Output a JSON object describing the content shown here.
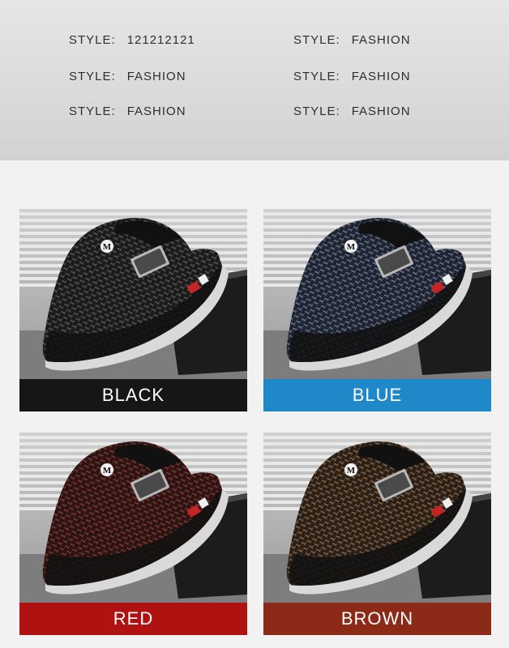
{
  "specs": [
    {
      "key": "STYLE:",
      "value": "121212121"
    },
    {
      "key": "STYLE:",
      "value": "FASHION"
    },
    {
      "key": "STYLE:",
      "value": "FASHION"
    },
    {
      "key": "STYLE:",
      "value": "FASHION"
    },
    {
      "key": "STYLE:",
      "value": "FASHION"
    },
    {
      "key": "STYLE:",
      "value": "FASHION"
    }
  ],
  "colors": [
    {
      "label": "BLACK",
      "bar_color": "#161616",
      "shoe_color": "#1b1b1b",
      "pattern_color": "#5a5a5a"
    },
    {
      "label": "BLUE",
      "bar_color": "#1e88c8",
      "shoe_color": "#1f2430",
      "pattern_color": "#6b7a93"
    },
    {
      "label": "RED",
      "bar_color": "#b01212",
      "shoe_color": "#2a1414",
      "pattern_color": "#8a3a2e"
    },
    {
      "label": "BROWN",
      "bar_color": "#8c2a18",
      "shoe_color": "#2a2018",
      "pattern_color": "#8a6a48"
    }
  ],
  "shoe_logo": "M"
}
